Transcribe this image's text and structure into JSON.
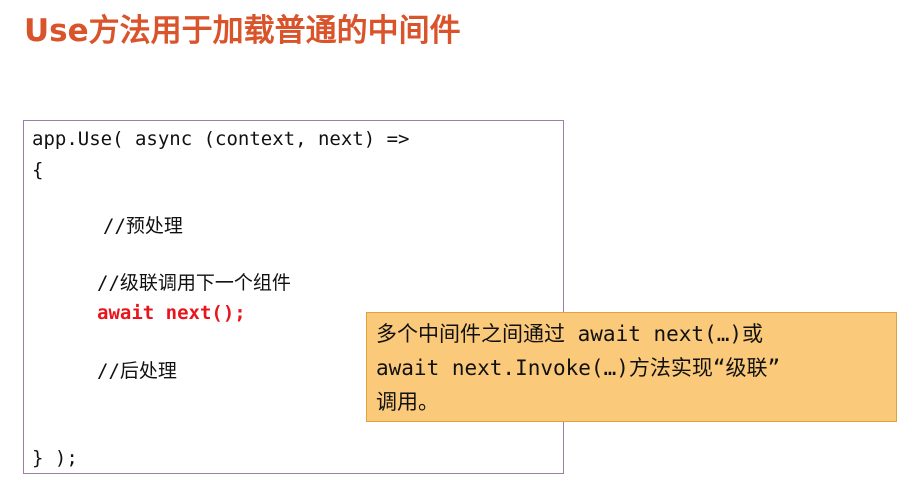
{
  "slide": {
    "title": "Use方法用于加载普通的中间件"
  },
  "code": {
    "line1": "app.Use( async (context, next) =>",
    "line2": "{",
    "comment_pre": "//预处理",
    "comment_chain": "//级联调用下一个组件",
    "await_line": "await next();",
    "comment_post": "//后处理",
    "closing": "} );"
  },
  "callout": {
    "line1": "多个中间件之间通过 await next(…)或",
    "line2": "await next.Invoke(…)方法实现“级联”",
    "line3": "调用。"
  },
  "colors": {
    "title": "#d9532b",
    "code_keyword_red": "#e8161c",
    "callout_bg": "#fbc97a",
    "box_border": "#9b7fa6"
  }
}
